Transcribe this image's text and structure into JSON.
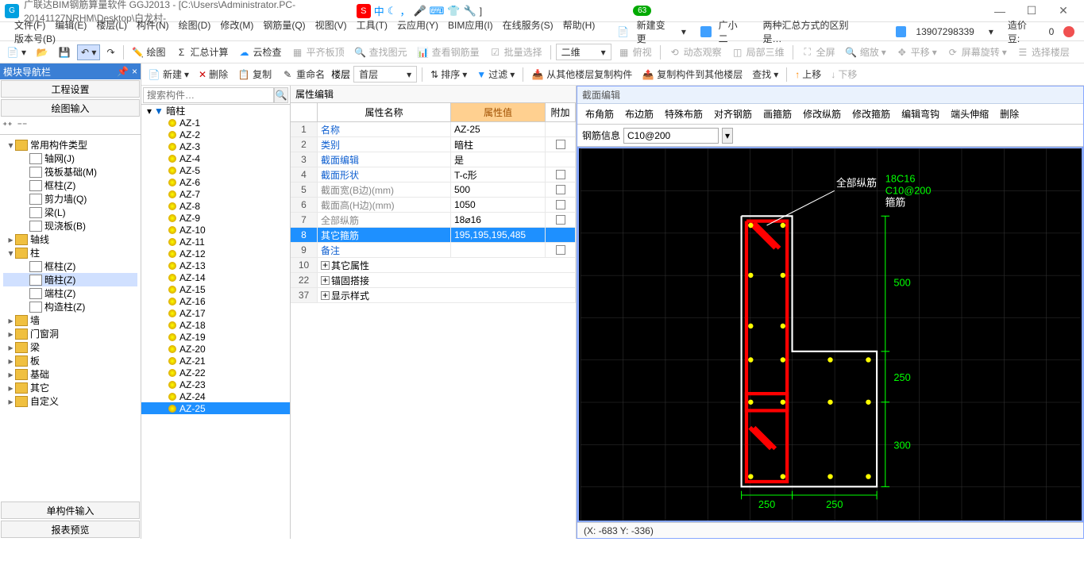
{
  "titlebar": {
    "app_name": "广联达BIM钢筋算量软件 GGJ2013 - [C:\\Users\\Administrator.PC-20141127NRHM\\Desktop\\白龙村-",
    "ime_chn": "中",
    "badge": "63"
  },
  "menubar": {
    "items": [
      "文件(F)",
      "编辑(E)",
      "楼层(L)",
      "构件(N)",
      "绘图(D)",
      "修改(M)",
      "钢筋量(Q)",
      "视图(V)",
      "工具(T)",
      "云应用(Y)",
      "BIM应用(I)",
      "在线服务(S)",
      "帮助(H)",
      "版本号(B)"
    ],
    "new_change": "新建变更",
    "user_avatar": "广小二",
    "notice": "两种汇总方式的区别是…",
    "phone": "13907298339",
    "credit_label": "造价豆:",
    "credit_val": "0"
  },
  "toolbar1": {
    "items": [
      "绘图",
      "汇总计算",
      "云检查",
      "平齐板顶",
      "查找图元",
      "查看钢筋量",
      "批量选择"
    ],
    "view_mode": "二维",
    "items2": [
      "俯视",
      "动态观察",
      "局部三维",
      "全屏",
      "缩放",
      "平移",
      "屏幕旋转",
      "选择楼层"
    ]
  },
  "toolbar3": {
    "items": [
      "新建",
      "删除",
      "复制",
      "重命名"
    ],
    "floor_lbl": "楼层",
    "floor_val": "首层",
    "sort": "排序",
    "filter": "过滤",
    "copy_from": "从其他楼层复制构件",
    "copy_to": "复制构件到其他楼层",
    "find": "查找",
    "up": "上移",
    "down": "下移"
  },
  "left_nav": {
    "header": "模块导航栏",
    "btn1": "工程设置",
    "btn2": "绘图输入",
    "tree": [
      {
        "t": "常用构件类型",
        "lvl": 0,
        "exp": true,
        "folder": true
      },
      {
        "t": "轴网(J)",
        "lvl": 1
      },
      {
        "t": "筏板基础(M)",
        "lvl": 1
      },
      {
        "t": "框柱(Z)",
        "lvl": 1
      },
      {
        "t": "剪力墙(Q)",
        "lvl": 1
      },
      {
        "t": "梁(L)",
        "lvl": 1
      },
      {
        "t": "现浇板(B)",
        "lvl": 1
      },
      {
        "t": "轴线",
        "lvl": 0,
        "folder": true,
        "closed": true
      },
      {
        "t": "柱",
        "lvl": 0,
        "folder": true,
        "exp": true
      },
      {
        "t": "框柱(Z)",
        "lvl": 1
      },
      {
        "t": "暗柱(Z)",
        "lvl": 1,
        "sel": true
      },
      {
        "t": "端柱(Z)",
        "lvl": 1
      },
      {
        "t": "构造柱(Z)",
        "lvl": 1
      },
      {
        "t": "墙",
        "lvl": 0,
        "folder": true,
        "closed": true
      },
      {
        "t": "门窗洞",
        "lvl": 0,
        "folder": true,
        "closed": true
      },
      {
        "t": "梁",
        "lvl": 0,
        "folder": true,
        "closed": true
      },
      {
        "t": "板",
        "lvl": 0,
        "folder": true,
        "closed": true
      },
      {
        "t": "基础",
        "lvl": 0,
        "folder": true,
        "closed": true
      },
      {
        "t": "其它",
        "lvl": 0,
        "folder": true,
        "closed": true
      },
      {
        "t": "自定义",
        "lvl": 0,
        "folder": true,
        "closed": true
      }
    ],
    "btn3": "单构件输入",
    "btn4": "报表预览"
  },
  "mid": {
    "search_ph": "搜索构件…",
    "root": "暗柱",
    "items": [
      "AZ-1",
      "AZ-2",
      "AZ-3",
      "AZ-4",
      "AZ-5",
      "AZ-6",
      "AZ-7",
      "AZ-8",
      "AZ-9",
      "AZ-10",
      "AZ-11",
      "AZ-12",
      "AZ-13",
      "AZ-14",
      "AZ-15",
      "AZ-16",
      "AZ-17",
      "AZ-18",
      "AZ-19",
      "AZ-20",
      "AZ-21",
      "AZ-22",
      "AZ-23",
      "AZ-24",
      "AZ-25"
    ],
    "sel": "AZ-25"
  },
  "prop": {
    "title": "属性编辑",
    "h_name": "属性名称",
    "h_val": "属性值",
    "h_add": "附加",
    "rows": [
      {
        "i": "1",
        "n": "名称",
        "v": "AZ-25",
        "add": false
      },
      {
        "i": "2",
        "n": "类别",
        "v": "暗柱",
        "add": true
      },
      {
        "i": "3",
        "n": "截面编辑",
        "v": "是",
        "add": false
      },
      {
        "i": "4",
        "n": "截面形状",
        "v": "T-c形",
        "add": true
      },
      {
        "i": "5",
        "n": "截面宽(B边)(mm)",
        "v": "500",
        "add": true
      },
      {
        "i": "6",
        "n": "截面高(H边)(mm)",
        "v": "1050",
        "add": true
      },
      {
        "i": "7",
        "n": "全部纵筋",
        "v": "18⌀16",
        "add": true
      },
      {
        "i": "8",
        "n": "其它箍筋",
        "v": "195,195,195,485",
        "add": false,
        "sel": true
      },
      {
        "i": "9",
        "n": "备注",
        "v": "",
        "add": true
      }
    ],
    "groups": [
      {
        "i": "10",
        "n": "其它属性"
      },
      {
        "i": "22",
        "n": "锚固搭接"
      },
      {
        "i": "37",
        "n": "显示样式"
      }
    ]
  },
  "canvas": {
    "title": "截面编辑",
    "tabs": [
      "布角筋",
      "布边筋",
      "特殊布筋",
      "对齐钢筋",
      "画箍筋",
      "修改纵筋",
      "修改箍筋",
      "编辑弯钩",
      "端头伸缩",
      "删除"
    ],
    "rebar_lbl": "钢筋信息",
    "rebar_val": "C10@200",
    "label_all": "全部纵筋",
    "label_r1": "18C16",
    "label_r2": "C10@200",
    "stirrup": "箍筋",
    "dim_500": "500",
    "dim_250": "250",
    "dim_300": "300",
    "status": "(X: -683 Y: -336)"
  }
}
